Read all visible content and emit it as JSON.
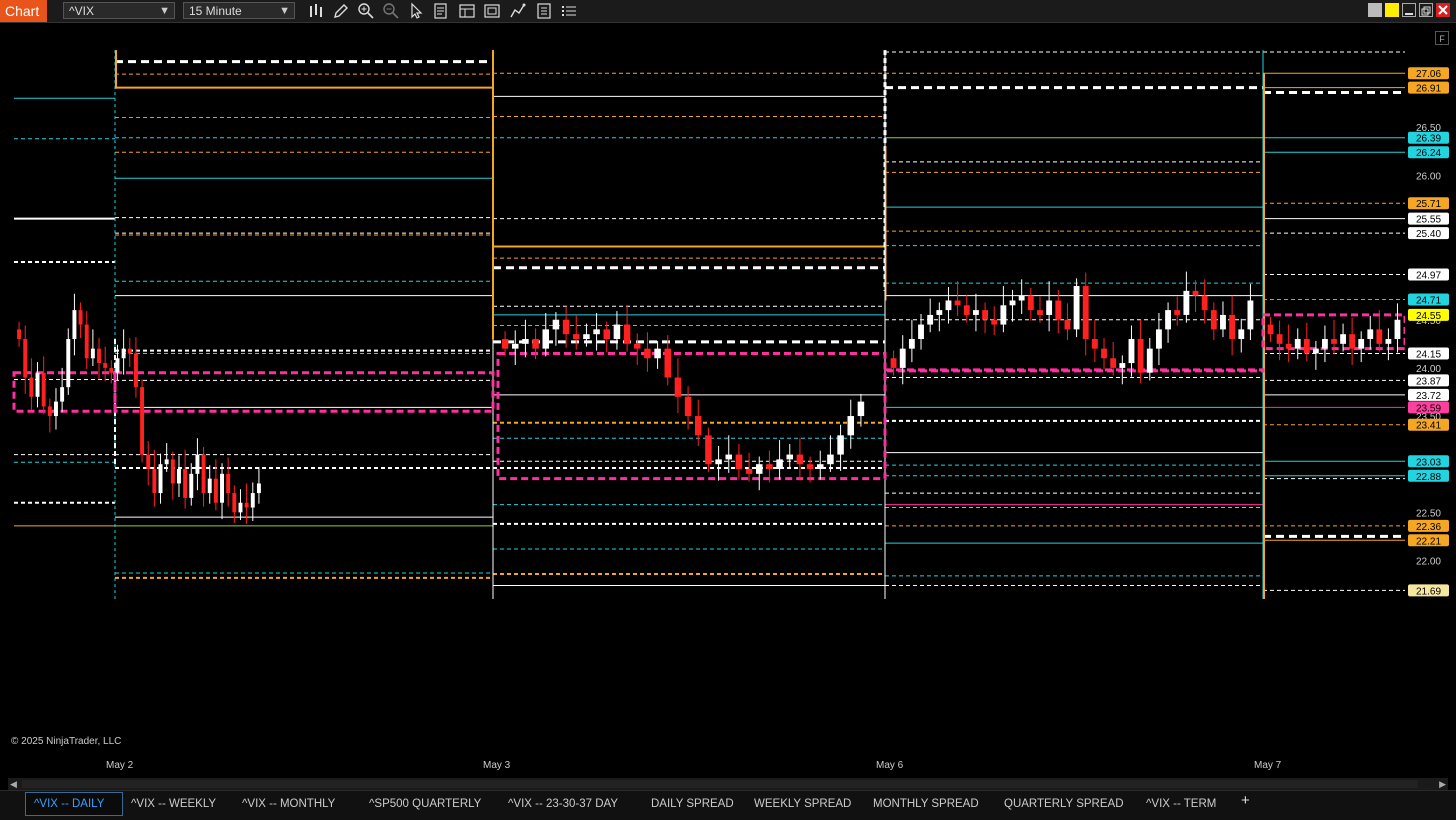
{
  "app": {
    "title": "Chart",
    "copyright": "© 2025 NinjaTrader, LLC"
  },
  "toolbar": {
    "instrument": "^VIX",
    "interval": "15 Minute",
    "icons": [
      "bars-type-icon",
      "draw-pencil-icon",
      "zoom-in-icon",
      "zoom-out-icon",
      "pointer-icon",
      "data-box-icon",
      "templates-icon",
      "properties-icon",
      "strategies-icon",
      "indicators-icon",
      "list-icon"
    ]
  },
  "window_controls": {
    "colors": [
      "#bbbbbb",
      "#ffee00"
    ]
  },
  "x_axis": {
    "labels": [
      "May 2",
      "May 3",
      "May 6",
      "May 7"
    ]
  },
  "y_axis": {
    "ticks": [
      "26.50",
      "26.00",
      "24.50",
      "24.00",
      "23.50",
      "22.50",
      "22.00"
    ],
    "price_markers": [
      {
        "text": "27.06",
        "bg": "#f5a623",
        "fg": "#000"
      },
      {
        "text": "26.91",
        "bg": "#f5a623",
        "fg": "#000"
      },
      {
        "text": "26.39",
        "bg": "#22d3e0",
        "fg": "#000"
      },
      {
        "text": "26.24",
        "bg": "#22d3e0",
        "fg": "#000"
      },
      {
        "text": "25.71",
        "bg": "#f5a623",
        "fg": "#000"
      },
      {
        "text": "25.55",
        "bg": "#ffffff",
        "fg": "#000"
      },
      {
        "text": "25.40",
        "bg": "#ffffff",
        "fg": "#000"
      },
      {
        "text": "24.97",
        "bg": "#ffffff",
        "fg": "#000"
      },
      {
        "text": "24.71",
        "bg": "#22d3e0",
        "fg": "#000"
      },
      {
        "text": "24.55",
        "bg": "#ffff00",
        "fg": "#000"
      },
      {
        "text": "24.15",
        "bg": "#ffffff",
        "fg": "#000"
      },
      {
        "text": "23.87",
        "bg": "#ffffff",
        "fg": "#000"
      },
      {
        "text": "23.72",
        "bg": "#ffffff",
        "fg": "#000"
      },
      {
        "text": "23.59",
        "bg": "#ff3fa0",
        "fg": "#000"
      },
      {
        "text": "23.41",
        "bg": "#f5a623",
        "fg": "#000"
      },
      {
        "text": "23.03",
        "bg": "#22d3e0",
        "fg": "#000"
      },
      {
        "text": "22.88",
        "bg": "#22d3e0",
        "fg": "#000"
      },
      {
        "text": "22.36",
        "bg": "#f5a623",
        "fg": "#000"
      },
      {
        "text": "22.21",
        "bg": "#f5a623",
        "fg": "#000"
      },
      {
        "text": "21.69",
        "bg": "#f5e6a0",
        "fg": "#000"
      }
    ]
  },
  "tabs": [
    {
      "label": "^VIX -- DAILY",
      "active": true
    },
    {
      "label": "^VIX -- WEEKLY"
    },
    {
      "label": "^VIX -- MONTHLY"
    },
    {
      "label": "^SP500 QUARTERLY"
    },
    {
      "label": "^VIX -- 23-30-37 DAY"
    },
    {
      "label": "DAILY SPREAD"
    },
    {
      "label": "WEEKLY SPREAD"
    },
    {
      "label": "MONTHLY SPREAD"
    },
    {
      "label": "QUARTERLY SPREAD"
    },
    {
      "label": "^VIX -- TERM"
    }
  ],
  "chart_data": {
    "type": "candlestick",
    "instrument": "^VIX",
    "interval": "15 Minute",
    "y_range": [
      21.6,
      27.2
    ],
    "colors": {
      "up": "#ffffff",
      "down": "#ff2020",
      "cyan": "#22d3e0",
      "orange": "#f5a623",
      "magenta": "#ff2fa0",
      "white": "#ffffff",
      "green": "#9acd32"
    },
    "sessions": [
      {
        "label": "May 2",
        "close_profile": [
          24.3,
          23.9,
          23.7,
          23.95,
          23.6,
          23.5,
          23.65,
          23.8,
          24.3,
          24.6,
          24.45,
          24.1,
          24.2,
          24.05,
          24.0,
          23.95,
          24.1,
          24.2,
          24.15,
          23.8,
          23.1,
          22.95,
          22.7,
          23.0,
          23.05,
          22.8,
          22.95,
          22.65,
          22.9,
          23.1,
          22.7,
          22.85,
          22.6,
          22.9,
          22.7,
          22.5,
          22.6,
          22.55,
          22.7,
          22.8
        ]
      },
      {
        "label": "May 3",
        "close_profile": [
          24.2,
          24.25,
          24.3,
          24.2,
          24.4,
          24.5,
          24.35,
          24.3,
          24.35,
          24.4,
          24.3,
          24.45,
          24.25,
          24.2,
          24.1,
          24.2,
          23.9,
          23.7,
          23.5,
          23.3,
          23.0,
          23.05,
          23.1,
          22.95,
          22.9,
          23.0,
          22.95,
          23.05,
          23.1,
          23.0,
          22.95,
          23.0,
          23.1,
          23.3,
          23.5,
          23.65
        ]
      },
      {
        "label": "May 6",
        "close_profile": [
          24.0,
          24.2,
          24.3,
          24.45,
          24.55,
          24.6,
          24.7,
          24.65,
          24.55,
          24.6,
          24.5,
          24.45,
          24.65,
          24.7,
          24.75,
          24.6,
          24.55,
          24.7,
          24.5,
          24.4,
          24.85,
          24.3,
          24.2,
          24.1,
          24.0,
          24.05,
          24.3,
          23.95,
          24.2,
          24.4,
          24.6,
          24.55,
          24.8,
          24.75,
          24.6,
          24.4,
          24.55,
          24.3,
          24.4,
          24.7
        ]
      },
      {
        "label": "May 7",
        "close_profile": [
          24.35,
          24.25,
          24.2,
          24.3,
          24.15,
          24.2,
          24.3,
          24.25,
          24.35,
          24.2,
          24.3,
          24.4,
          24.25,
          24.3,
          24.5
        ]
      }
    ]
  }
}
